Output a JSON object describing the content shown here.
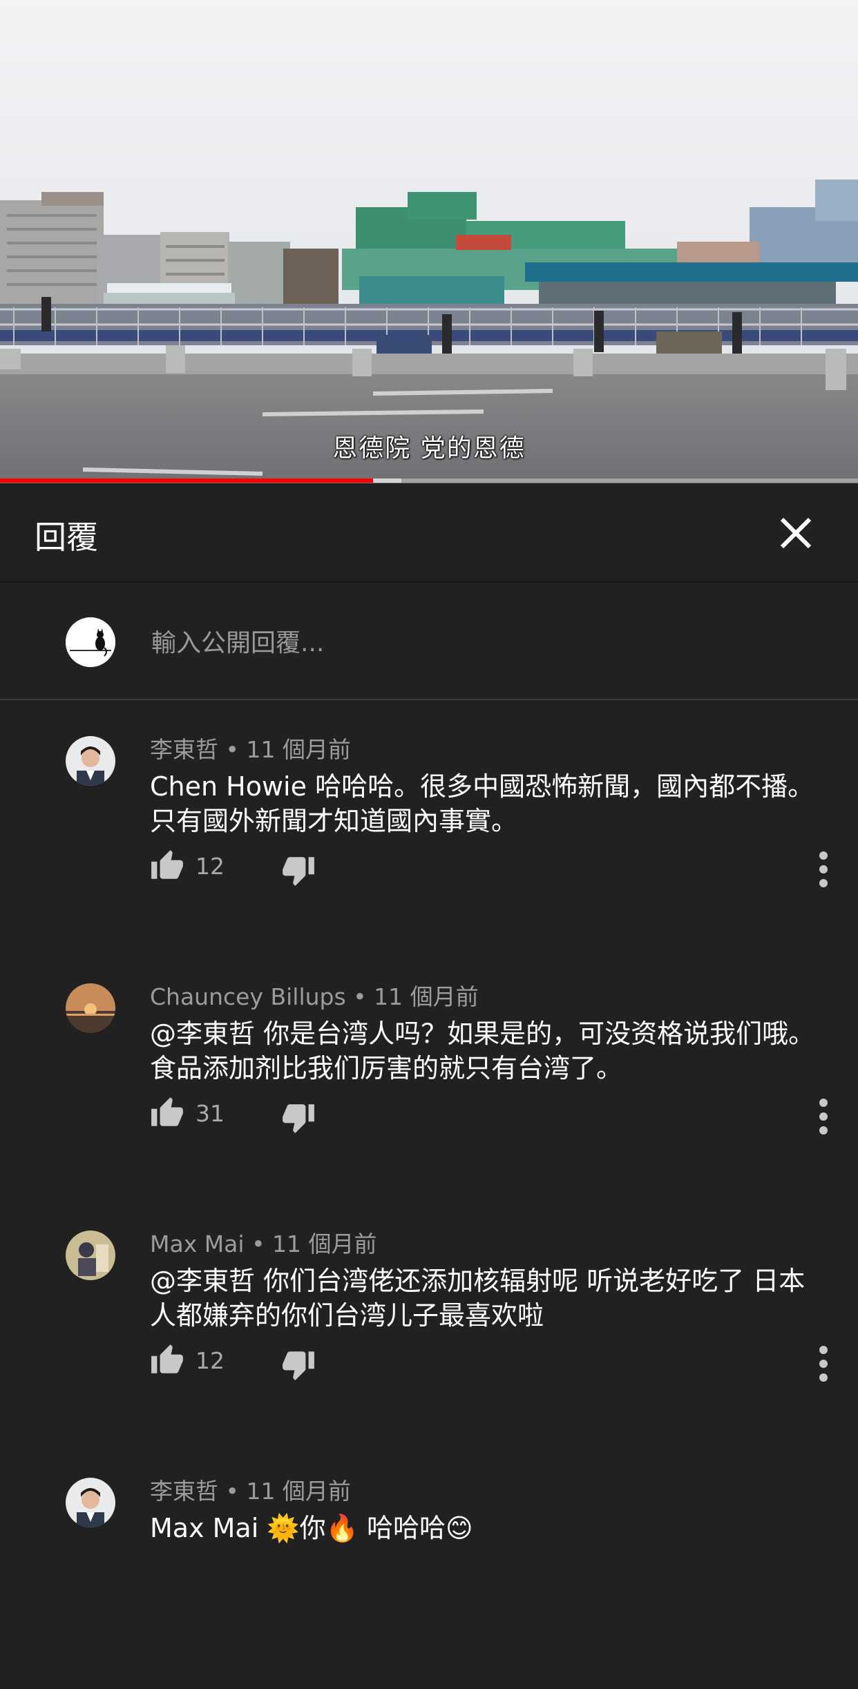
{
  "video": {
    "subtitle": "恩德院  党的恩德",
    "progress": 0.435,
    "buffered": 0.468
  },
  "panel": {
    "title": "回覆",
    "close_icon": "close-icon"
  },
  "reply": {
    "placeholder": "輸入公開回覆..."
  },
  "comments": [
    {
      "meta": "李東哲 • 11 個月前",
      "text": "Chen Howie 哈哈哈。很多中國恐怖新聞，國內都不播。只有國外新聞才知道國內事實。",
      "likes": "12"
    },
    {
      "meta": "Chauncey Billups • 11 個月前",
      "text": "@李東哲 你是台湾人吗？如果是的，可没资格说我们哦。食品添加剂比我们厉害的就只有台湾了。",
      "likes": "31"
    },
    {
      "meta": "Max Mai • 11 個月前",
      "text": "@李東哲 你们台湾佬还添加核辐射呢 听说老好吃了 日本人都嫌弃的你们台湾儿子最喜欢啦",
      "likes": "12"
    },
    {
      "meta": "李東哲 • 11 個月前",
      "text": "Max Mai 🌞你🔥 哈哈哈😊",
      "likes": ""
    }
  ],
  "colors": {
    "background": "#212121",
    "progress": "#ff0000",
    "meta_text": "#9c9c9c"
  }
}
